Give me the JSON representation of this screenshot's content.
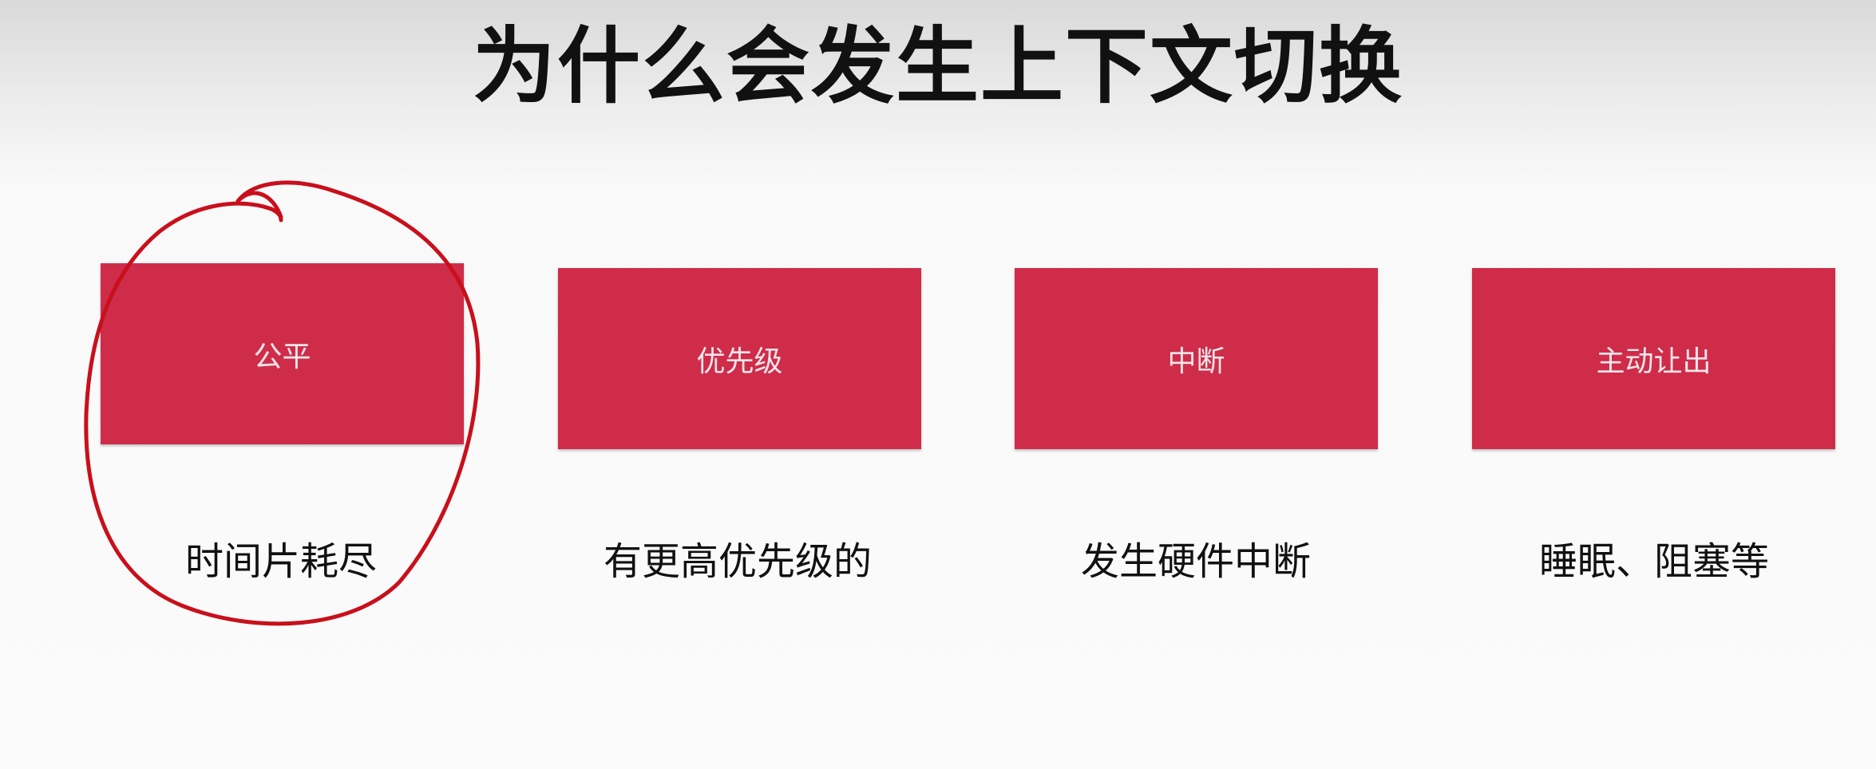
{
  "slide": {
    "title": "为什么会发生上下文切换"
  },
  "cards": [
    {
      "label": "公平",
      "caption": "时间片耗尽"
    },
    {
      "label": "优先级",
      "caption": "有更高优先级的"
    },
    {
      "label": "中断",
      "caption": "发生硬件中断"
    },
    {
      "label": "主动让出",
      "caption": "睡眠、阻塞等"
    }
  ],
  "colors": {
    "box_fill": "#cf2c4a",
    "box_text": "#f4e6ea",
    "annotation": "#c8101c"
  }
}
